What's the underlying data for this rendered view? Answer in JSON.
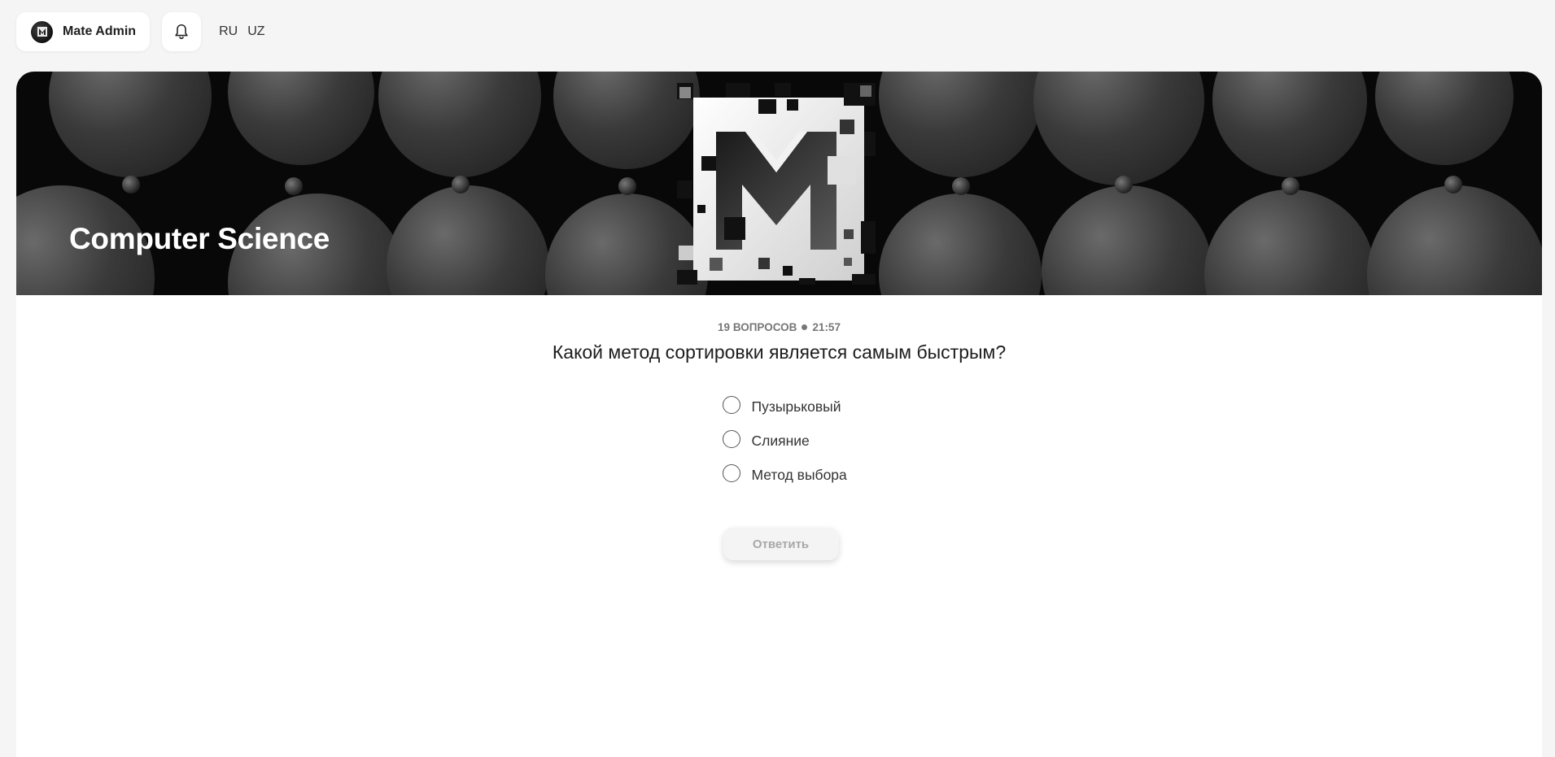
{
  "header": {
    "user_name": "Mate Admin",
    "languages": [
      "RU",
      "UZ"
    ]
  },
  "course": {
    "title": "Computer Science"
  },
  "quiz": {
    "questions_count": "19 ВОПРОСОВ",
    "timer": "21:57",
    "question": "Какой метод сортировки является самым быстрым?",
    "options": [
      "Пузырьковый",
      "Слияние",
      "Метод выбора"
    ],
    "submit_label": "Ответить"
  }
}
